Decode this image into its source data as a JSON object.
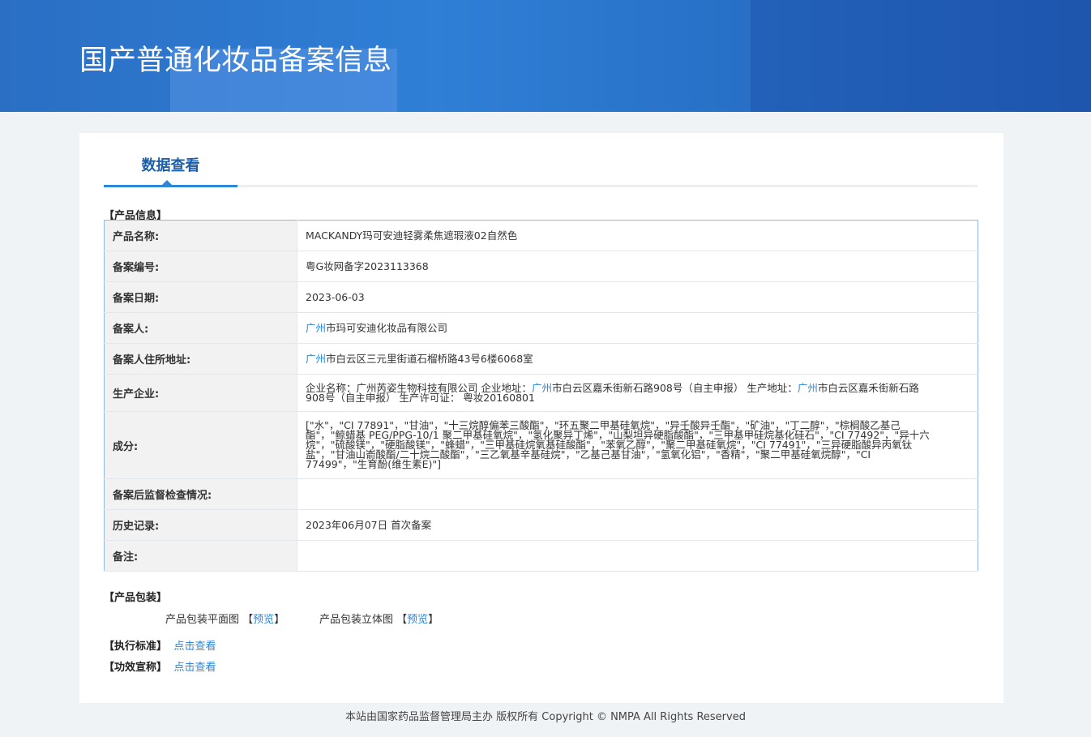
{
  "header": {
    "title": "国产普通化妆品备案信息"
  },
  "tab": {
    "label": "数据查看"
  },
  "sections": {
    "product_info": "【产品信息】",
    "packaging": "【产品包装】",
    "standard": "【执行标准】",
    "efficacy": "【功效宣称】"
  },
  "rows": [
    {
      "label": "产品名称:",
      "value": "MACKANDY玛可安迪轻雾柔焦遮瑕液02自然色"
    },
    {
      "label": "备案编号:",
      "value": "粤G妆网备字2023113368"
    },
    {
      "label": "备案日期:",
      "value": "2023-06-03"
    },
    {
      "label": "备案人:",
      "value_prefix": "广州",
      "value": "市玛可安迪化妆品有限公司"
    },
    {
      "label": "备案人住所地址:",
      "value_prefix": "广州",
      "value": "市白云区三元里街道石榴桥路43号6楼6068室"
    },
    {
      "label": "生产企业:",
      "value_a": "企业名称：广州芮姿生物科技有限公司 企业地址：",
      "value_b": "广州",
      "value_c": "市白云区嘉禾街新石路908号（自主申报） 生产地址：",
      "value_d": "广州",
      "value_e": "市白云区嘉禾街新石路908号（自主申报） 生产许可证：  粤妆20160801"
    },
    {
      "label": "成分:",
      "value": "[\"水\"，\"CI 77891\"，\"甘油\"，\"十三烷醇偏苯三酸酯\"，\"环五聚二甲基硅氧烷\"，\"异壬酸异壬酯\"，\"矿油\"，\"丁二醇\"，\"棕榈酸乙基己酯\"，\"鲸蜡基 PEG/PPG-10/1 聚二甲基硅氧烷\"，\"氢化聚异丁烯\"，\"山梨坦异硬脂酸酯\"，\"三甲基甲硅烷基化硅石\"，\"CI 77492\"，\"异十六烷\"，\"硫酸镁\"，\"硬脂酸镁\"，\"蜂蜡\"，\"三甲基硅烷氧基硅酸酯\"，\"苯氧乙醇\"，\"聚二甲基硅氧烷\"，\"CI 77491\"，\"三异硬脂酸异丙氧钛盐\"，\"甘油山嵛酸酯/二十烷二酸酯\"，\"三乙氧基辛基硅烷\"，\"乙基己基甘油\"，\"氢氧化铝\"，\"香精\"，\"聚二甲基硅氧烷醇\"，\"CI 77499\"，\"生育酚(维生素E)\"]"
    },
    {
      "label": "备案后监督检查情况:",
      "value": ""
    },
    {
      "label": "历史记录:",
      "value": "2023年06月07日 首次备案"
    },
    {
      "label": "备注:",
      "value": ""
    }
  ],
  "packaging": {
    "flat_label": "产品包装平面图",
    "flat_link": "预览",
    "three_d_label": "产品包装立体图",
    "three_d_link": "预览",
    "bracket_open": "【",
    "bracket_close": "】"
  },
  "links": {
    "standard": "点击查看",
    "efficacy": "点击查看"
  },
  "footer": "本站由国家药品监督管理局主办 版权所有 Copyright © NMPA All Rights Reserved",
  "colors": {
    "accent": "#2e86d9",
    "banner": "#2a6fc4"
  }
}
